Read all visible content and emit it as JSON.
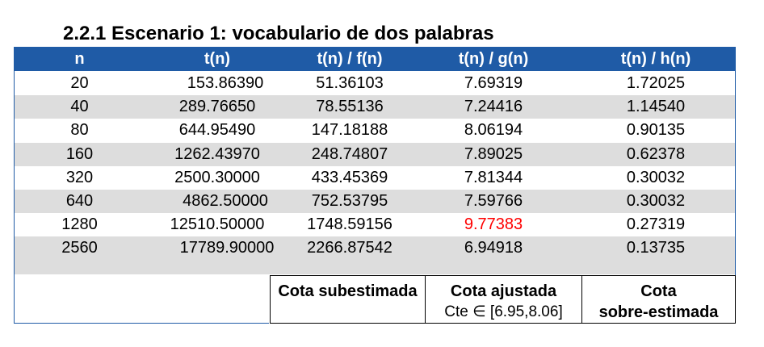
{
  "title": "2.2.1  Escenario 1: vocabulario de dos palabras",
  "headers": [
    "n",
    "t(n)",
    "t(n) / f(n)",
    "t(n) / g(n)",
    "t(n) / h(n)"
  ],
  "rows": [
    [
      "20",
      "153.86390",
      "51.36103",
      "7.69319",
      "1.72025"
    ],
    [
      "40",
      "289.76650",
      "78.55136",
      "7.24416",
      "1.14540"
    ],
    [
      "80",
      "644.95490",
      "147.18188",
      "8.06194",
      "0.90135"
    ],
    [
      "160",
      "1262.43970",
      "248.74807",
      "7.89025",
      "0.62378"
    ],
    [
      "320",
      "2500.30000",
      "433.45369",
      "7.81344",
      "0.30032"
    ],
    [
      "640",
      "4862.50000",
      "752.53795",
      "7.59766",
      "0.30032"
    ],
    [
      "1280",
      "12510.50000",
      "1748.59156",
      "9.77383",
      "0.27319"
    ],
    [
      "2560",
      "17789.90000",
      "2266.87542",
      "6.94918",
      "0.13735"
    ]
  ],
  "footer": {
    "sub": "Cota subestimada",
    "adj": "Cota ajustada",
    "adj_note": "Cte ∈ [6.95,8.06]",
    "over_1": "Cota",
    "over_2": "sobre-estimada"
  },
  "highlight_color": "#ff0000",
  "header_color": "#1f5ba6"
}
